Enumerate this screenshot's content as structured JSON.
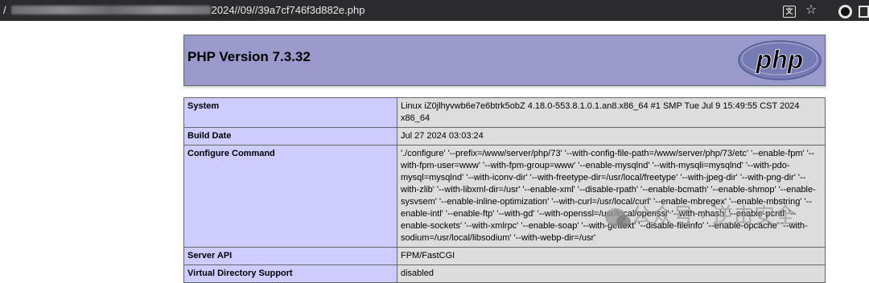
{
  "browser": {
    "url_prefix": "/",
    "url_path": "2024//09//39a7cf746f3d882e.php",
    "translate_icon": "translate-icon",
    "star_icon": "star-icon",
    "profile_icon": "profile-icon",
    "extension_icon": "extension-icon"
  },
  "phpinfo": {
    "title": "PHP Version 7.3.32",
    "logo_text": "php",
    "rows": [
      {
        "key": "System",
        "value": "Linux iZ0jlhyvwb6e7e6btrk5obZ 4.18.0-553.8.1.0.1.an8.x86_64 #1 SMP Tue Jul 9 15:49:55 CST 2024 x86_64"
      },
      {
        "key": "Build Date",
        "value": "Jul 27 2024 03:03:24"
      },
      {
        "key": "Configure Command",
        "value": "'./configure' '--prefix=/www/server/php/73' '--with-config-file-path=/www/server/php/73/etc' '--enable-fpm' '--with-fpm-user=www' '--with-fpm-group=www' '--enable-mysqlnd' '--with-mysqli=mysqlnd' '--with-pdo-mysql=mysqlnd' '--with-iconv-dir' '--with-freetype-dir=/usr/local/freetype' '--with-jpeg-dir' '--with-png-dir' '--with-zlib' '--with-libxml-dir=/usr' '--enable-xml' '--disable-rpath' '--enable-bcmath' '--enable-shmop' '--enable-sysvsem' '--enable-inline-optimization' '--with-curl=/usr/local/curl' '--enable-mbregex' '--enable-mbstring' '--enable-intl' '--enable-ftp' '--with-gd' '--with-openssl=/usr/local/openssl' '--with-mhash' '--enable-pcntl' '--enable-sockets' '--with-xmlrpc' '--enable-soap' '--with-gettext' '--disable-fileinfo' '--enable-opcache' '--with-sodium=/usr/local/libsodium' '--with-webp-dir=/usr'"
      },
      {
        "key": "Server API",
        "value": "FPM/FastCGI"
      },
      {
        "key": "Virtual Directory Support",
        "value": "disabled"
      }
    ]
  },
  "watermark": {
    "text": "公众号 · 逆击安全"
  },
  "colors": {
    "header_bg": "#9999cc",
    "key_bg": "#ccccff",
    "value_bg": "#dddddd",
    "logo_fill": "#777bb3"
  }
}
